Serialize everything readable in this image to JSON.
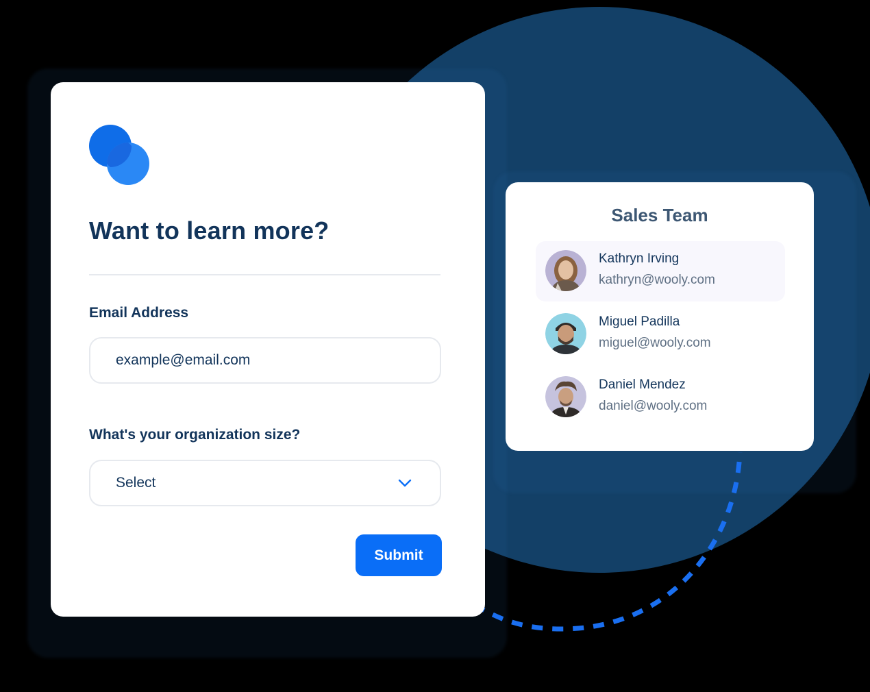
{
  "form": {
    "title": "Want to learn more?",
    "email_label": "Email Address",
    "email_placeholder": "example@email.com",
    "org_label": "What's your organization size?",
    "org_select_value": "Select",
    "submit_label": "Submit"
  },
  "team": {
    "title": "Sales Team",
    "members": [
      {
        "name": "Kathryn Irving",
        "email": "kathryn@wooly.com",
        "highlighted": true
      },
      {
        "name": "Miguel Padilla",
        "email": "miguel@wooly.com",
        "highlighted": false
      },
      {
        "name": "Daniel Mendez",
        "email": "daniel@wooly.com",
        "highlighted": false
      }
    ]
  },
  "icons": {
    "logo": "overlapping-circles-logo",
    "select_chevron": "chevron-down-icon"
  },
  "colors": {
    "background": "#000000",
    "circle": "#134067",
    "primary": "#0a6ef7",
    "heading": "#12345a",
    "muted": "#5e6f83",
    "border": "#e6e9ee"
  }
}
